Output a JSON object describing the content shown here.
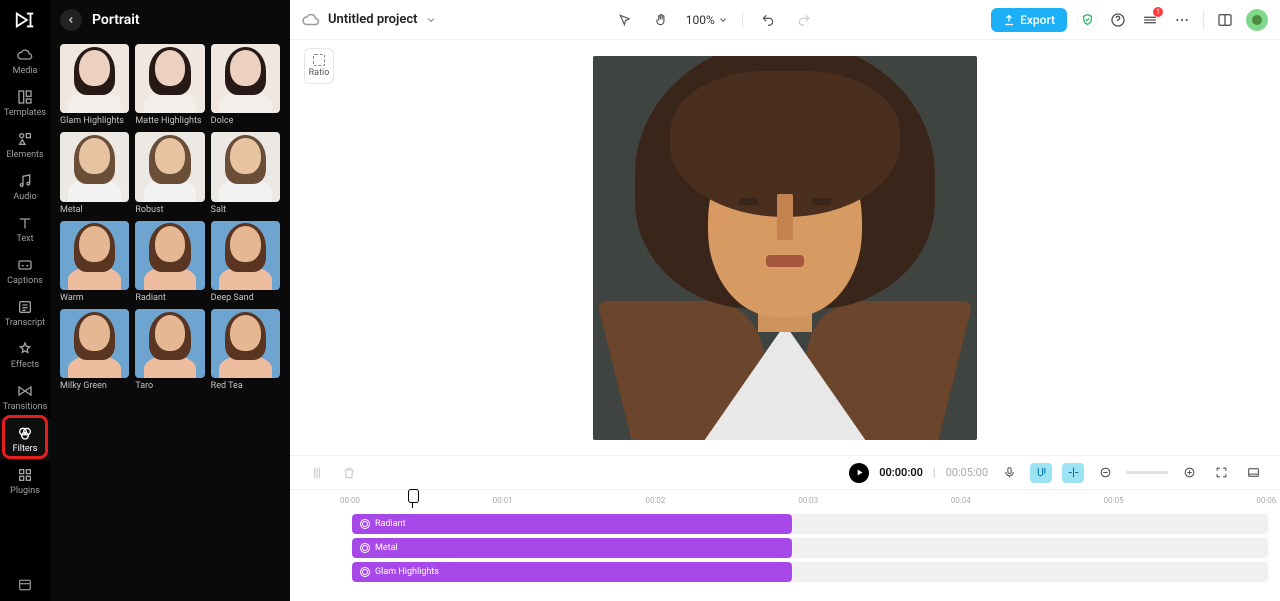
{
  "nav": {
    "items": [
      {
        "key": "media",
        "label": "Media"
      },
      {
        "key": "templates",
        "label": "Templates"
      },
      {
        "key": "elements",
        "label": "Elements"
      },
      {
        "key": "audio",
        "label": "Audio"
      },
      {
        "key": "text",
        "label": "Text"
      },
      {
        "key": "captions",
        "label": "Captions"
      },
      {
        "key": "transcript",
        "label": "Transcript"
      },
      {
        "key": "effects",
        "label": "Effects"
      },
      {
        "key": "transitions",
        "label": "Transitions"
      },
      {
        "key": "filters",
        "label": "Filters"
      },
      {
        "key": "plugins",
        "label": "Plugins"
      }
    ],
    "active_key": "filters"
  },
  "panel": {
    "title": "Portrait",
    "filters": [
      {
        "label": "Glam Highlights",
        "row": "row1"
      },
      {
        "label": "Matte Highlights",
        "row": "row1"
      },
      {
        "label": "Dolce",
        "row": "row1"
      },
      {
        "label": "Metal",
        "row": "row2"
      },
      {
        "label": "Robust",
        "row": "row2"
      },
      {
        "label": "Salt",
        "row": "row2"
      },
      {
        "label": "Warm",
        "row": "row3"
      },
      {
        "label": "Radiant",
        "row": "row3"
      },
      {
        "label": "Deep Sand",
        "row": "row3"
      },
      {
        "label": "Milky Green",
        "row": "row4"
      },
      {
        "label": "Taro",
        "row": "row4"
      },
      {
        "label": "Red Tea",
        "row": "row4"
      }
    ]
  },
  "topbar": {
    "project_name": "Untitled project",
    "zoom": "100%",
    "export_label": "Export",
    "notification_count": "1"
  },
  "ratio": {
    "label": "Ratio"
  },
  "playback": {
    "current": "00:00:00",
    "total": "00:05:00"
  },
  "ruler": {
    "ticks": [
      {
        "label": "00:00",
        "pct": 0
      },
      {
        "label": "00:01",
        "pct": 16.6
      },
      {
        "label": "00:02",
        "pct": 33.2
      },
      {
        "label": "00:03",
        "pct": 49.8
      },
      {
        "label": "00:04",
        "pct": 66.4
      },
      {
        "label": "00:05",
        "pct": 83.0
      },
      {
        "label": "00:06",
        "pct": 99.6
      }
    ]
  },
  "tracks": [
    {
      "label": "Radiant",
      "width_pct": 48
    },
    {
      "label": "Metal",
      "width_pct": 48
    },
    {
      "label": "Glam Highlights",
      "width_pct": 48
    }
  ]
}
